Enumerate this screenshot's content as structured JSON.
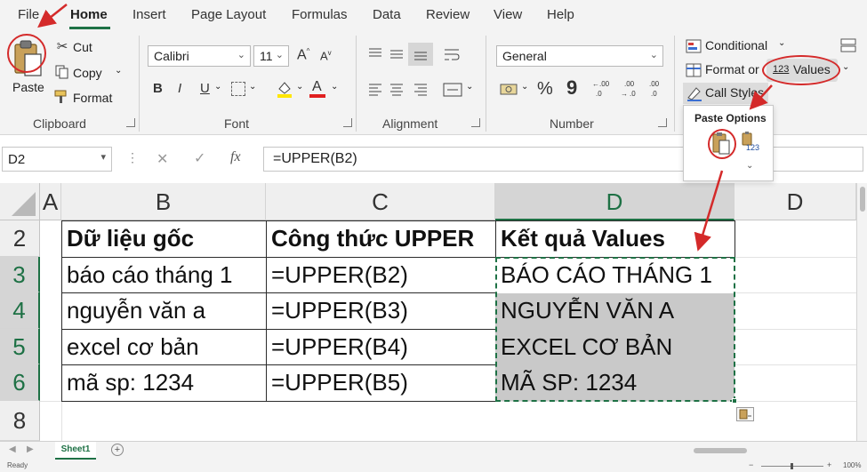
{
  "menu": {
    "tabs": [
      "File",
      "Home",
      "Insert",
      "Page Layout",
      "Formulas",
      "Data",
      "Review",
      "View",
      "Help"
    ],
    "active_tab": "Home"
  },
  "ribbon": {
    "clipboard": {
      "paste_label": "Paste",
      "cut_label": "Cut",
      "copy_label": "Copy",
      "format_label": "Format",
      "group_label": "Clipboard"
    },
    "font": {
      "font_name": "Calibri",
      "font_size": "11",
      "bold": "B",
      "italic": "I",
      "underline": "U",
      "font_color_glyph": "A",
      "group_label": "Font"
    },
    "alignment": {
      "group_label": "Alignment"
    },
    "number": {
      "format": "General",
      "percent": "%",
      "comma": "9",
      "inc_decimal": ".0",
      "inc_decimal_b": ".00",
      "dec_decimal": ".00",
      "dec_decimal_b": ".0",
      "inc_decimal_top": "←",
      "dec_decimal_top": "→",
      "group_label": "Number"
    },
    "styles": {
      "conditional_label": "Conditional",
      "format_as_label": "Format or",
      "call_styles_label": "Call Styles",
      "values_icon_text": "123",
      "values_label": "Values"
    }
  },
  "paste_options": {
    "title": "Paste Options",
    "values_icon_text": "123"
  },
  "formula_bar": {
    "name_box": "D2",
    "cancel": "✕",
    "enter": "✓",
    "fx": "fx",
    "formula": "=UPPER(B2)"
  },
  "grid": {
    "columns": [
      "A",
      "B",
      "C",
      "D",
      "D"
    ],
    "rows": [
      "2",
      "3",
      "4",
      "5",
      "6",
      "8"
    ],
    "headers": {
      "B": "Dữ liệu gốc",
      "C": "Công thức UPPER",
      "D": "Kết quả Values"
    },
    "data": [
      {
        "b": "báo cáo tháng 1",
        "c": "=UPPER(B2)",
        "d": "BÁO CÁO THÁNG 1"
      },
      {
        "b": "nguyễn văn a",
        "c": "=UPPER(B3)",
        "d": "NGUYỄN VĂN A"
      },
      {
        "b": "excel cơ bản",
        "c": "=UPPER(B4)",
        "d": "EXCEL CƠ BẢN"
      },
      {
        "b": "mã sp: 1234",
        "c": "=UPPER(B5)",
        "d": "MÃ SP: 1234"
      }
    ]
  },
  "sheet_tabs": {
    "active": "Sheet1",
    "add": "+"
  },
  "status": {
    "ready": "Ready",
    "zoom": "100%"
  },
  "colors": {
    "accent_green": "#1e7145",
    "annotation_red": "#d42a2a",
    "shaded_cell": "#c9c9c9"
  }
}
